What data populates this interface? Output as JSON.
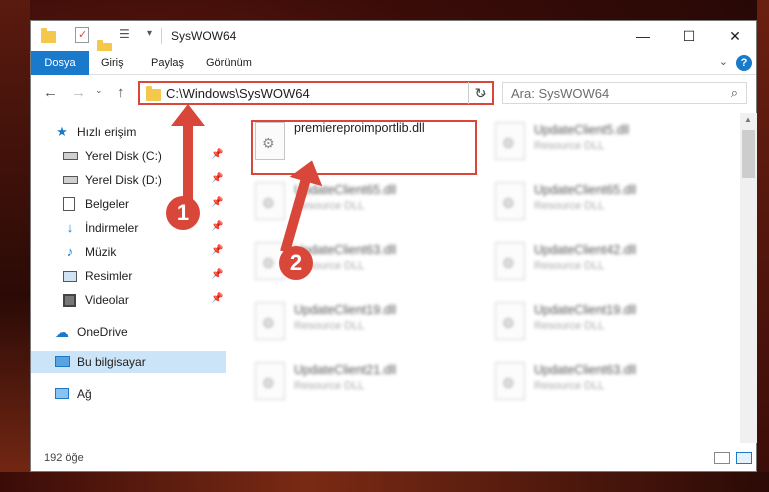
{
  "window": {
    "title": "SysWOW64",
    "controls": {
      "minimize": "—",
      "maximize": "☐",
      "close": "✕"
    }
  },
  "ribbon": {
    "tabs": [
      {
        "label": "Dosya",
        "active": true
      },
      {
        "label": "Giriş",
        "active": false
      },
      {
        "label": "Paylaş",
        "active": false
      },
      {
        "label": "Görünüm",
        "active": false
      }
    ],
    "help": "?"
  },
  "address": {
    "path": "C:\\Windows\\SysWOW64",
    "search_placeholder": "Ara: SysWOW64"
  },
  "sidebar": {
    "items": [
      {
        "label": "Hızlı erişim",
        "icon": "star-icon",
        "pinned": false
      },
      {
        "label": "Yerel Disk (C:)",
        "icon": "drive-icon",
        "pinned": true
      },
      {
        "label": "Yerel Disk (D:)",
        "icon": "drive-icon",
        "pinned": true
      },
      {
        "label": "Belgeler",
        "icon": "documents-icon",
        "pinned": true
      },
      {
        "label": "İndirmeler",
        "icon": "download-icon",
        "pinned": true
      },
      {
        "label": "Müzik",
        "icon": "music-icon",
        "pinned": true
      },
      {
        "label": "Resimler",
        "icon": "pictures-icon",
        "pinned": true
      },
      {
        "label": "Videolar",
        "icon": "videos-icon",
        "pinned": true
      },
      {
        "label": "OneDrive",
        "icon": "cloud-icon",
        "pinned": false
      },
      {
        "label": "Bu bilgisayar",
        "icon": "computer-icon",
        "pinned": false,
        "selected": true
      },
      {
        "label": "Ağ",
        "icon": "network-icon",
        "pinned": false
      }
    ]
  },
  "files": {
    "highlighted": {
      "name": "premiereproimportlib.dll",
      "type": ""
    },
    "left_column": [
      {
        "name": "UpdateClient65.dll",
        "type": "Resource DLL"
      },
      {
        "name": "UpdateClient63.dll",
        "type": "Resource DLL"
      },
      {
        "name": "UpdateClient19.dll",
        "type": "Resource DLL"
      },
      {
        "name": "UpdateClient21.dll",
        "type": "Resource DLL"
      }
    ],
    "right_column": [
      {
        "name": "UpdateClient5.dll",
        "type": "Resource DLL"
      },
      {
        "name": "UpdateClient65.dll",
        "type": "Resource DLL"
      },
      {
        "name": "UpdateClient42.dll",
        "type": "Resource DLL"
      },
      {
        "name": "UpdateClient19.dll",
        "type": "Resource DLL"
      },
      {
        "name": "UpdateClient63.dll",
        "type": "Resource DLL"
      }
    ]
  },
  "status": {
    "item_count": "192 öğe"
  },
  "annotations": {
    "marker1": "1",
    "marker2": "2",
    "color": "#d9473a"
  }
}
